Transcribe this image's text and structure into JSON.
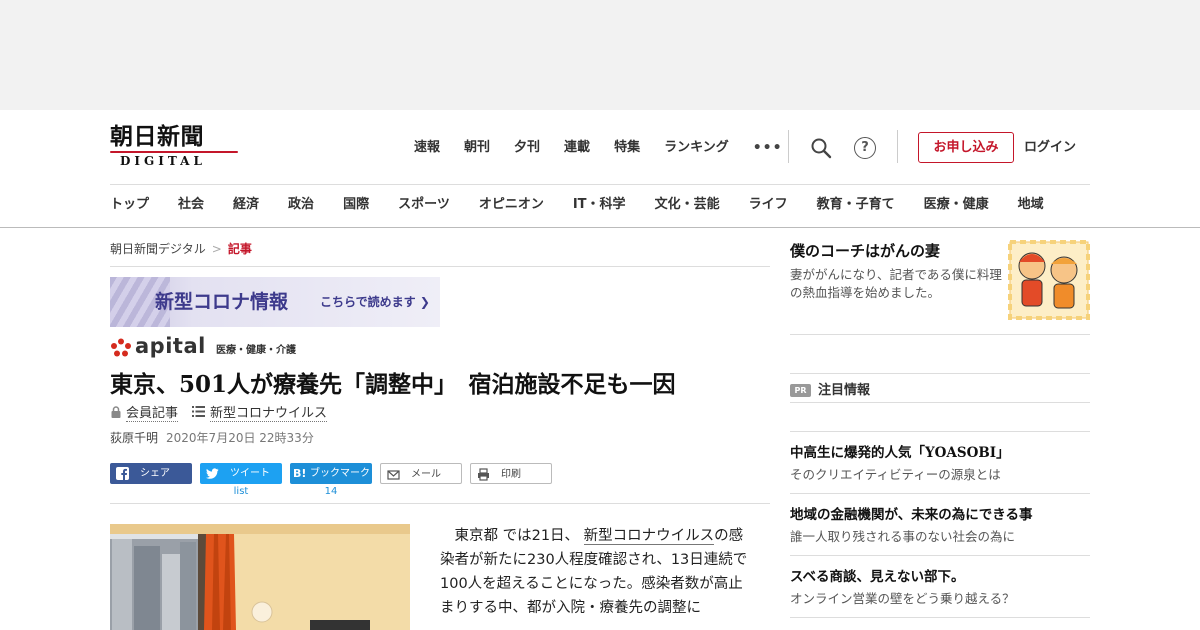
{
  "logo": {
    "main": "朝日新聞",
    "sub": "DIGITAL"
  },
  "topnav": {
    "items": [
      "速報",
      "朝刊",
      "夕刊",
      "連載",
      "特集",
      "ランキング"
    ],
    "more": "•••"
  },
  "header_actions": {
    "help": "?",
    "apply": "お申し込み",
    "login": "ログイン"
  },
  "catnav": {
    "items": [
      "トップ",
      "社会",
      "経済",
      "政治",
      "国際",
      "スポーツ",
      "オピニオン",
      "IT・科学",
      "文化・芸能",
      "ライフ",
      "教育・子育て",
      "医療・健康",
      "地域"
    ]
  },
  "breadcrumb": {
    "home": "朝日新聞デジタル",
    "sep": ">",
    "current": "記事"
  },
  "banner": {
    "main": "新型コロナ情報",
    "sub": "こちらで読めます ❯"
  },
  "apital": {
    "name": "apital",
    "tag": "医療・健康・介護"
  },
  "article": {
    "headline": "東京、501人が療養先「調整中」　宿泊施設不足も一因",
    "member": "会員記事",
    "topic": "新型コロナウイルス",
    "author": "荻原千明",
    "date": "2020年7月20日 22時33分",
    "body_prefix": "東京都",
    "body_mid": " では21日、 ",
    "body_link": "新型コロナウイルス",
    "body_rest": "の感染者が新たに230人程度確認され、13日連続で100人を超えることになった。感染者数が高止まりする中、都が入院・療養先の調整に"
  },
  "share": {
    "facebook": "シェア",
    "twitter": "ツイート",
    "hatena_b": "B!",
    "hatena": "ブックマーク",
    "mail": "メール",
    "print": "印刷",
    "twitter_count": "list",
    "hatena_count": "14"
  },
  "sidebar": {
    "feature": {
      "title": "僕のコーチはがんの妻",
      "desc": "妻ががんになり、記者である僕に料理の熱血指導を始めました。"
    },
    "pr": {
      "badge": "PR",
      "label": "注目情報"
    },
    "items": [
      {
        "title": "中高生に爆発的人気「YOASOBI」",
        "desc": "そのクリエイティビティーの源泉とは"
      },
      {
        "title": "地域の金融機関が、未来の為にできる事",
        "desc": "誰一人取り残される事のない社会の為に"
      },
      {
        "title": "スベる商談、見えない部下。",
        "desc": "オンライン営業の壁をどう乗り越える？"
      }
    ]
  },
  "colors": {
    "brand_red": "#c4162a",
    "facebook": "#3b5998",
    "twitter": "#1da1f2",
    "hatena": "#1d8fd8",
    "banner_purple": "#3d3a8c"
  },
  "icons": [
    "search-icon",
    "help-icon",
    "lock-icon",
    "list-icon",
    "facebook-icon",
    "twitter-icon",
    "mail-icon",
    "print-icon",
    "apital-logo-icon"
  ]
}
